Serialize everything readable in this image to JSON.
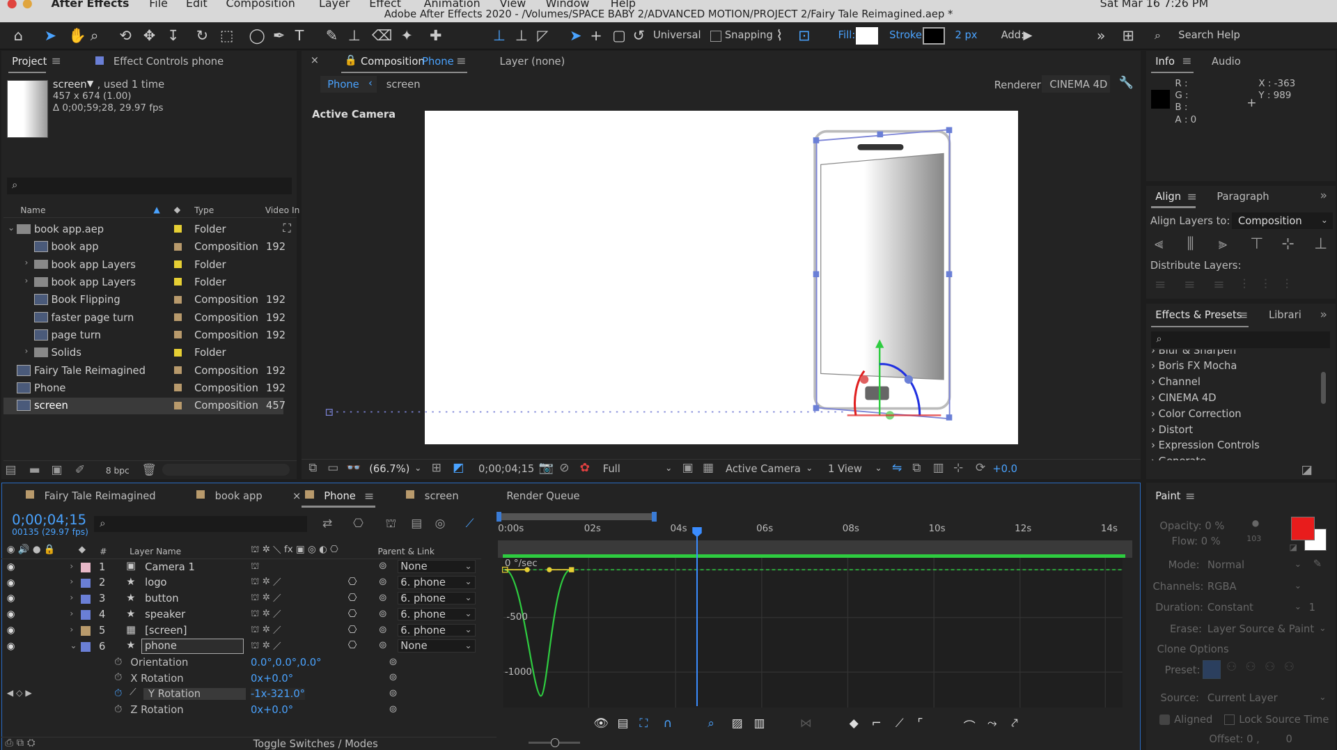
{
  "menubar": {
    "app": "After Effects",
    "items": [
      "File",
      "Edit",
      "Composition",
      "Layer",
      "Effect",
      "Animation",
      "View",
      "Window",
      "Help"
    ],
    "datetime": "Sat Mar 16 7:26 PM",
    "window_title": "Adobe After Effects 2020 - /Volumes/SPACE BABY 2/ADVANCED MOTION/PROJECT 2/Fairy Tale Reimagined.aep *"
  },
  "toolbar": {
    "universal": "Universal",
    "snapping": "Snapping",
    "fill": "Fill:",
    "stroke": "Stroke:",
    "stroke_width": "2 px",
    "add": "Add:",
    "search_help": "Search Help"
  },
  "project": {
    "tab": "Project",
    "effect_controls": "Effect Controls phone",
    "selected_name": "screen",
    "used": ", used 1 time",
    "dims": "457 x 674 (1.00)",
    "duration": "Δ 0;00;59;28, 29.97 fps",
    "col_name": "Name",
    "col_type": "Type",
    "col_video": "Video In",
    "bpc": "8 bpc",
    "items": [
      {
        "name": "book app.aep",
        "type": "Folder",
        "video": "",
        "color": "#e6cf34"
      },
      {
        "name": "book app",
        "type": "Composition",
        "video": "192",
        "color": "#b89a6c"
      },
      {
        "name": "book app Layers",
        "type": "Folder",
        "video": "",
        "color": "#e6cf34"
      },
      {
        "name": "book app Layers",
        "type": "Folder",
        "video": "",
        "color": "#e6cf34"
      },
      {
        "name": "Book Flipping",
        "type": "Composition",
        "video": "192",
        "color": "#b89a6c"
      },
      {
        "name": "faster page turn",
        "type": "Composition",
        "video": "192",
        "color": "#b89a6c"
      },
      {
        "name": "page turn",
        "type": "Composition",
        "video": "192",
        "color": "#b89a6c"
      },
      {
        "name": "Solids",
        "type": "Folder",
        "video": "",
        "color": "#e6cf34"
      },
      {
        "name": "Fairy Tale Reimagined",
        "type": "Composition",
        "video": "192",
        "color": "#b89a6c"
      },
      {
        "name": "Phone",
        "type": "Composition",
        "video": "192",
        "color": "#b89a6c"
      },
      {
        "name": "screen",
        "type": "Composition",
        "video": "457",
        "color": "#b89a6c"
      }
    ]
  },
  "composition": {
    "tab_prefix": "Composition",
    "tab_name": "Phone",
    "layer_tab": "Layer (none)",
    "crumb1": "Phone",
    "crumb2": "screen",
    "renderer_label": "Renderer:",
    "renderer": "CINEMA 4D",
    "camera_label": "Active Camera",
    "zoom": "(66.7%)",
    "timecode": "0;00;04;15",
    "quality": "Full",
    "view_camera": "Active Camera",
    "views": "1 View",
    "exposure": "+0.0"
  },
  "info": {
    "tab": "Info",
    "audio_tab": "Audio",
    "r": "R :",
    "g": "G :",
    "b": "B :",
    "a": "A :  0",
    "x": "X : -363",
    "y": "Y : 989"
  },
  "align": {
    "tab": "Align",
    "paragraph": "Paragraph",
    "align_to": "Align Layers to:",
    "target": "Composition",
    "distribute": "Distribute Layers:"
  },
  "effects": {
    "tab": "Effects & Presets",
    "libraries": "Librari",
    "items": [
      "Blur & Sharpen",
      "Boris FX Mocha",
      "Channel",
      "CINEMA 4D",
      "Color Correction",
      "Distort",
      "Expression Controls",
      "Generate"
    ]
  },
  "timeline": {
    "tabs": [
      {
        "label": "Fairy Tale Reimagined",
        "color": "#b89a6c"
      },
      {
        "label": "book app",
        "color": "#b89a6c"
      },
      {
        "label": "Phone",
        "color": "#b89a6c"
      },
      {
        "label": "screen",
        "color": "#b89a6c"
      }
    ],
    "render_queue": "Render Queue",
    "timecode": "0;00;04;15",
    "frames": "00135 (29.97 fps)",
    "col_layer": "Layer Name",
    "col_parent": "Parent & Link",
    "col_hash": "#",
    "toggle": "Toggle Switches / Modes",
    "layers": [
      {
        "num": "1",
        "name": "Camera 1",
        "parent": "None",
        "color": "#e8b8c8"
      },
      {
        "num": "2",
        "name": "logo",
        "parent": "6. phone",
        "color": "#6a7fd6"
      },
      {
        "num": "3",
        "name": "button",
        "parent": "6. phone",
        "color": "#6a7fd6"
      },
      {
        "num": "4",
        "name": "speaker",
        "parent": "6. phone",
        "color": "#6a7fd6"
      },
      {
        "num": "5",
        "name": "[screen]",
        "parent": "6. phone",
        "color": "#b89a6c"
      },
      {
        "num": "6",
        "name": "phone",
        "parent": "None",
        "color": "#6a7fd6"
      }
    ],
    "props": [
      {
        "name": "Orientation",
        "value": "0.0°,0.0°,0.0°"
      },
      {
        "name": "X Rotation",
        "value": "0x+0.0°"
      },
      {
        "name": "Y Rotation",
        "value": "-1x-321.0°"
      },
      {
        "name": "Z Rotation",
        "value": "0x+0.0°"
      }
    ],
    "ruler": [
      "0:00s",
      "02s",
      "04s",
      "06s",
      "08s",
      "10s",
      "12s",
      "14s"
    ],
    "graph_unit": "0 °/sec",
    "graph_labels": [
      "-500",
      "-1000"
    ]
  },
  "paint": {
    "tab": "Paint",
    "opacity": "Opacity:  0 %",
    "flow": "Flow:  0 %",
    "brush_size": "103",
    "mode_label": "Mode:",
    "mode": "Normal",
    "channels_label": "Channels:",
    "channels": "RGBA",
    "duration_label": "Duration:",
    "duration": "Constant",
    "duration_val": "1",
    "erase_label": "Erase:",
    "erase": "Layer Source & Paint",
    "clone": "Clone Options",
    "preset": "Preset:",
    "source_label": "Source:",
    "source": "Current Layer",
    "aligned": "Aligned",
    "lock": "Lock Source Time",
    "offset": "Offset:  0 ,",
    "offset_y": "0",
    "fg_color": "#e81c1c"
  }
}
